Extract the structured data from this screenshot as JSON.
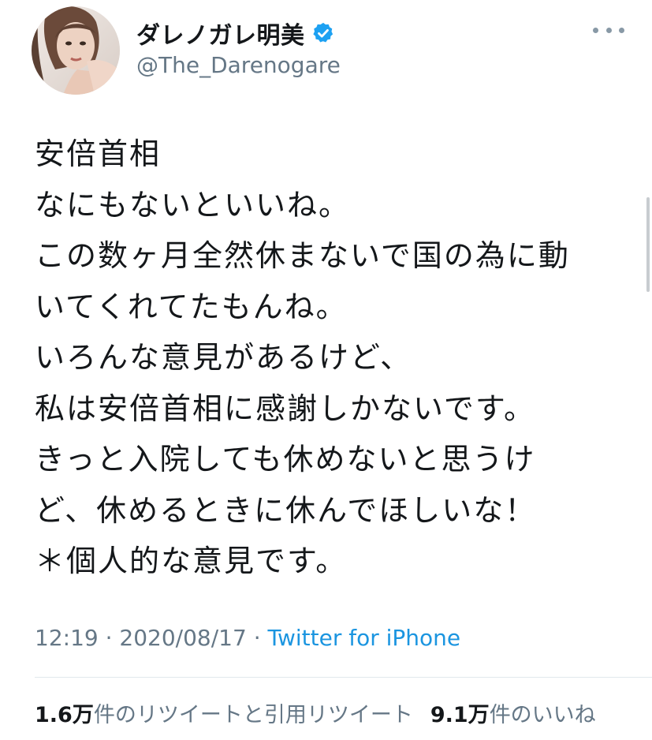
{
  "profile": {
    "display_name": "ダレノガレ明美",
    "handle": "@The_Darenogare",
    "verified_icon": "verified-badge-icon",
    "avatar_icon": "profile-photo"
  },
  "menu": {
    "more_icon": "more-horizontal-icon"
  },
  "tweet": {
    "lines": [
      "安倍首相",
      "なにもないといいね。",
      "この数ヶ月全然休まないで国の為に動",
      "いてくれてたもんね。",
      "いろんな意見があるけど、",
      "私は安倍首相に感謝しかないです。",
      "きっと入院しても休めないと思うけ",
      "ど、休めるときに休んでほしいな！",
      "＊個人的な意見です。"
    ]
  },
  "meta": {
    "time": "12:19",
    "separator": " · ",
    "date": "2020/08/17",
    "source": "Twitter for iPhone"
  },
  "stats": {
    "retweets_count": "1.6万",
    "retweets_label": "件のリツイートと引用リツイート",
    "likes_count": "9.1万",
    "likes_label": "件のいいね"
  },
  "colors": {
    "text": "#14171a",
    "secondary": "#657786",
    "link": "#1b95e0",
    "verified": "#1da1f2",
    "divider": "#e1e8ed"
  }
}
